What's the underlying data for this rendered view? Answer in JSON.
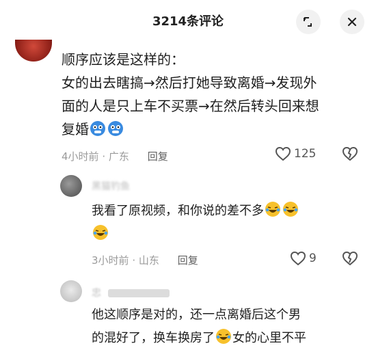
{
  "header": {
    "title": "3214条评论",
    "expand_icon": "expand-icon",
    "close_icon": "close-icon"
  },
  "comments": [
    {
      "body_lines": [
        "顺序应该是这样的：",
        "女的出去瞎搞→然后打她导致离婚→发现外",
        "面的人是只上车不买票→在然后转头回来想",
        "复婚"
      ],
      "time": "4小时前",
      "sep": "·",
      "location": "广东",
      "reply_label": "回复",
      "likes": "125"
    },
    {
      "author": "黑猫钓鱼",
      "body_lines": [
        "我看了原视频，和你说的差不多"
      ],
      "time": "3小时前",
      "sep": "·",
      "location": "山东",
      "reply_label": "回复",
      "likes": "9"
    },
    {
      "author": "忠",
      "body_lines": [
        "他这顺序是对的，还一点离婚后这个男",
        "的混好了，换车换房了",
        "女的心里不平"
      ]
    }
  ],
  "icons": {
    "like": "heart-outline-icon",
    "dislike": "broken-heart-icon",
    "emoji_cold": "cold-face-emoji-icon",
    "emoji_laugh": "laughing-crying-emoji-icon"
  },
  "colors": {
    "text": "#1f1f1f",
    "meta": "#9a9a9a",
    "button_bg": "#f1f1f1"
  }
}
